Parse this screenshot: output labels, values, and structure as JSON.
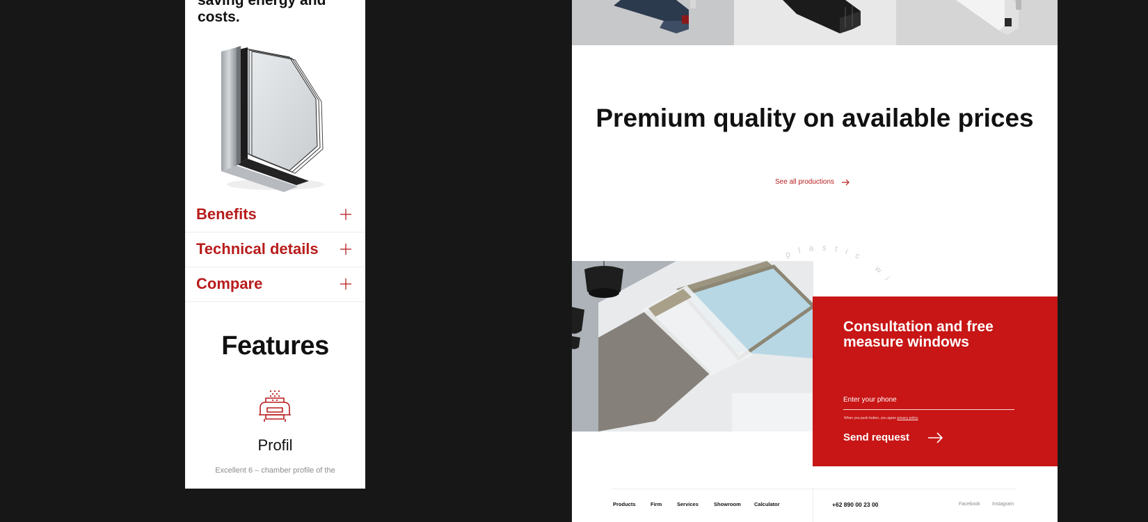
{
  "mobile": {
    "headline": "saving energy and costs.",
    "accordion": [
      {
        "label": "Benefits"
      },
      {
        "label": "Technical details"
      },
      {
        "label": "Compare"
      }
    ],
    "features_title": "Features",
    "feature": {
      "title": "Profil",
      "description": "Excellent 6 – chamber profile of the"
    }
  },
  "desktop": {
    "title": "Premium quality on available prices",
    "see_all": "See all productions",
    "arc_text": "tern plastic windo",
    "consultation": {
      "title": "Consultation and free measure windows",
      "phone_placeholder": "Enter your phone",
      "note": "When you push button, you agree",
      "note_link": "privacy policy",
      "send_label": "Send request"
    },
    "footer": {
      "nav": [
        "Products",
        "Firm",
        "Services",
        "Showroom",
        "Calculator"
      ],
      "phone": "+62 890 00 23 00",
      "social": [
        "Facebook",
        "Instagram"
      ]
    }
  },
  "colors": {
    "accent": "#c81515",
    "accent_text": "#b81c1c",
    "background": "#171717",
    "panel": "#ffffff"
  },
  "icons": [
    "plus-icon",
    "arrow-right-icon",
    "profile-feature-icon"
  ]
}
